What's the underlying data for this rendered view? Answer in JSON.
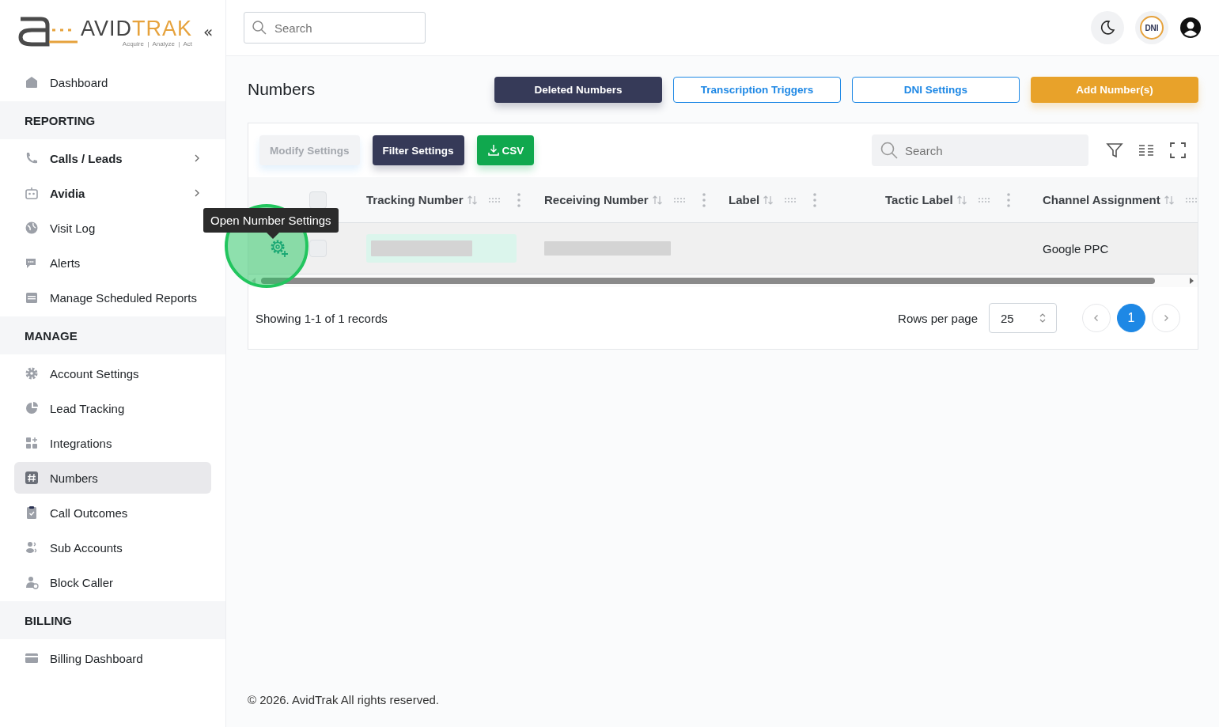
{
  "sidebar": {
    "logo": {
      "word_left": "AVID",
      "word_right": "TRAK",
      "tagline": "Acquire  |  Analyze  |  Act"
    },
    "collapse": "«",
    "items": [
      {
        "kind": "item",
        "label": "Dashboard",
        "selected": false,
        "submenu": false,
        "bold": false
      },
      {
        "kind": "section",
        "label": "REPORTING"
      },
      {
        "kind": "item",
        "label": "Calls / Leads",
        "selected": false,
        "submenu": true,
        "bold": true
      },
      {
        "kind": "item",
        "label": "Avidia",
        "selected": false,
        "submenu": true,
        "bold": true
      },
      {
        "kind": "item",
        "label": "Visit Log",
        "selected": false,
        "submenu": false,
        "bold": false
      },
      {
        "kind": "item",
        "label": "Alerts",
        "selected": false,
        "submenu": false,
        "bold": false
      },
      {
        "kind": "item",
        "label": "Manage Scheduled Reports",
        "selected": false,
        "submenu": false,
        "bold": false
      },
      {
        "kind": "section",
        "label": "MANAGE"
      },
      {
        "kind": "item",
        "label": "Account Settings",
        "selected": false,
        "submenu": false,
        "bold": false
      },
      {
        "kind": "item",
        "label": "Lead Tracking",
        "selected": false,
        "submenu": false,
        "bold": false
      },
      {
        "kind": "item",
        "label": "Integrations",
        "selected": false,
        "submenu": false,
        "bold": false
      },
      {
        "kind": "item",
        "label": "Numbers",
        "selected": true,
        "submenu": false,
        "bold": false
      },
      {
        "kind": "item",
        "label": "Call Outcomes",
        "selected": false,
        "submenu": false,
        "bold": false
      },
      {
        "kind": "item",
        "label": "Sub Accounts",
        "selected": false,
        "submenu": false,
        "bold": false
      },
      {
        "kind": "item",
        "label": "Block Caller",
        "selected": false,
        "submenu": false,
        "bold": false
      },
      {
        "kind": "section",
        "label": "BILLING"
      },
      {
        "kind": "item",
        "label": "Billing Dashboard",
        "selected": false,
        "submenu": false,
        "bold": false
      }
    ]
  },
  "topbar": {
    "search": {
      "placeholder": "Search"
    },
    "badge": "DNI"
  },
  "page": {
    "title": "Numbers",
    "actions": [
      {
        "kind": "dark",
        "label": "Deleted Numbers"
      },
      {
        "kind": "outline",
        "label": "Transcription Triggers"
      },
      {
        "kind": "outline",
        "label": "DNI Settings"
      },
      {
        "kind": "orange",
        "label": "Add Number(s)"
      }
    ]
  },
  "table": {
    "toolbar": [
      {
        "kind": "light",
        "label": "Modify Settings",
        "disabled": true
      },
      {
        "kind": "dark",
        "label": "Filter Settings",
        "disabled": false
      },
      {
        "kind": "green",
        "label": "CSV",
        "disabled": false
      }
    ],
    "search": {
      "placeholder": "Search"
    },
    "select_all_checked": false,
    "columns": [
      "Tracking Number",
      "Receiving Number",
      "Label",
      "Tactic Label",
      "Channel Assignment"
    ],
    "rows": [
      {
        "checked": false,
        "cells": [
          {
            "kind": "redacted"
          },
          {
            "kind": "redacted"
          },
          {
            "kind": "empty"
          },
          {
            "kind": "empty"
          },
          {
            "kind": "text",
            "text": "Google PPC"
          }
        ]
      }
    ],
    "tooltip": "Open Number Settings",
    "showing": "Showing 1-1 of 1 records",
    "rows_per_page_label": "Rows per page",
    "rows_per_page": "25",
    "pages": [
      {
        "label": "1",
        "selected": true
      }
    ]
  },
  "footer": "© 2026. AvidTrak All rights reserved."
}
